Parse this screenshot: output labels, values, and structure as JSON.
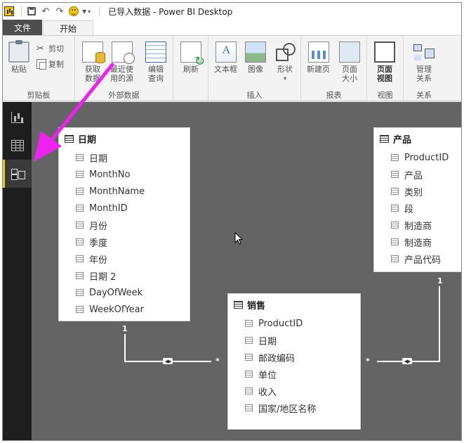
{
  "window": {
    "title": "已导入数据 - Power BI Desktop"
  },
  "tabs": {
    "file": "文件",
    "home": "开始"
  },
  "ribbon": {
    "clipboard": {
      "label": "剪贴板",
      "paste": "粘贴",
      "cut": "剪切",
      "copy": "复制"
    },
    "external_data": {
      "label": "外部数据",
      "get_data_1": "获取",
      "get_data_2": "数据",
      "recent_1": "最近使",
      "recent_2": "用的源",
      "edit_1": "编辑",
      "edit_2": "查询"
    },
    "refresh": {
      "label": "刷新"
    },
    "insert": {
      "label": "插入",
      "textbox": "文本框",
      "image": "图像",
      "shapes": "形状"
    },
    "report": {
      "label": "报表",
      "newpage": "新建页",
      "pagesize_1": "页面",
      "pagesize_2": "大小"
    },
    "view": {
      "label": "视图",
      "pageview_1": "页面",
      "pageview_2": "视图"
    },
    "relations": {
      "label": "关系",
      "manage_1": "管理",
      "manage_2": "关系"
    }
  },
  "tables": {
    "date": {
      "title": "日期",
      "fields": [
        "日期",
        "MonthNo",
        "MonthName",
        "MonthID",
        "月份",
        "季度",
        "年份",
        "日期 2",
        "DayOfWeek",
        "WeekOfYear"
      ]
    },
    "product": {
      "title": "产品",
      "fields": [
        "ProductID",
        "产品",
        "类别",
        "段",
        "制造商",
        "制造商",
        "产品代码"
      ]
    },
    "sales": {
      "title": "销售",
      "fields": [
        "ProductID",
        "日期",
        "邮政编码",
        "单位",
        "收入",
        "国家/地区名称"
      ]
    }
  },
  "relationships": {
    "date_sales": {
      "one": "1",
      "many": "*"
    },
    "product_sales": {
      "one": "1",
      "many": "*"
    }
  },
  "colors": {
    "accent_yellow": "#f2c811",
    "arrow_magenta": "#ee22ee",
    "canvas": "#646464",
    "leftnav": "#1e1e1e"
  }
}
